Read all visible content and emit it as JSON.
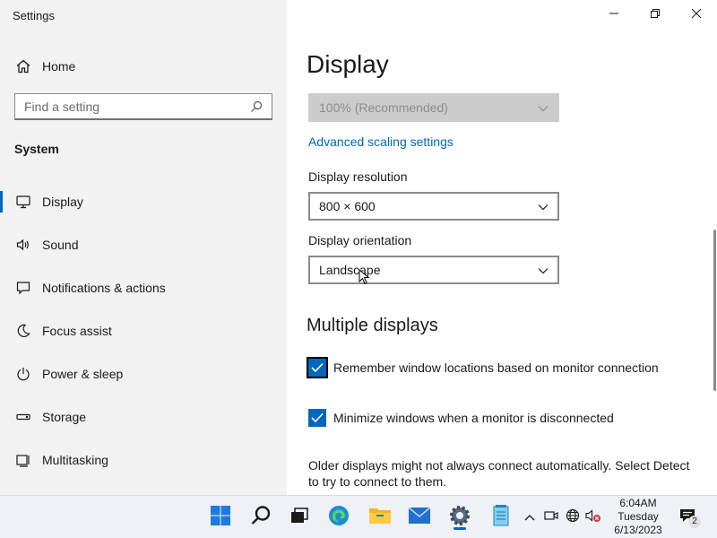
{
  "window": {
    "title": "Settings"
  },
  "sidebar": {
    "home_label": "Home",
    "search_placeholder": "Find a setting",
    "section": "System",
    "items": [
      {
        "label": "Display",
        "icon": "monitor-icon",
        "active": true
      },
      {
        "label": "Sound",
        "icon": "speaker-icon"
      },
      {
        "label": "Notifications & actions",
        "icon": "notification-icon"
      },
      {
        "label": "Focus assist",
        "icon": "moon-icon"
      },
      {
        "label": "Power & sleep",
        "icon": "power-icon"
      },
      {
        "label": "Storage",
        "icon": "storage-icon"
      },
      {
        "label": "Multitasking",
        "icon": "multitasking-icon"
      }
    ]
  },
  "main": {
    "title": "Display",
    "scale": {
      "value": "100% (Recommended)",
      "disabled": true
    },
    "advanced_link": "Advanced scaling settings",
    "resolution": {
      "label": "Display resolution",
      "value": "800 × 600"
    },
    "orientation": {
      "label": "Display orientation",
      "value": "Landscape"
    },
    "multiple_displays": {
      "heading": "Multiple displays",
      "remember": {
        "label": "Remember window locations based on monitor connection",
        "checked": true
      },
      "minimize": {
        "label": "Minimize windows when a monitor is disconnected",
        "checked": true
      },
      "note": "Older displays might not always connect automatically. Select Detect to try to connect to them."
    }
  },
  "taskbar": {
    "clock": {
      "time": "6:04AM",
      "day": "Tuesday",
      "date": "6/13/2023"
    },
    "notification_count": "2"
  },
  "colors": {
    "accent": "#0067c0",
    "sidebar_bg": "#f2f2f2",
    "taskbar_bg": "#eef1f6"
  }
}
